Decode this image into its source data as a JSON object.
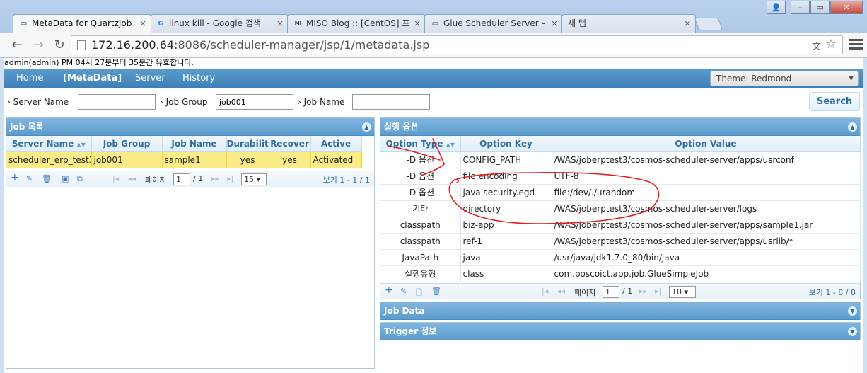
{
  "browser": {
    "tabs": [
      {
        "title": "MetaData for QuartzJob",
        "icon": "page-icon"
      },
      {
        "title": "linux kill - Google 검색",
        "icon": "google-icon"
      },
      {
        "title": "MISO Blog :: [CentOS] 프",
        "icon": "miso-icon"
      },
      {
        "title": "Glue Scheduler Server –",
        "icon": "page-icon"
      },
      {
        "title": "새 탭",
        "icon": ""
      }
    ],
    "url_host": "172.16.200.64",
    "url_rest": ":8086/scheduler-manager/jsp/1/metadata.jsp"
  },
  "notice": "admin(admin) PM 04시 27분부터 35분간 유효합니다.",
  "nav": {
    "items": [
      "Home",
      "[MetaData]",
      "Server",
      "History"
    ],
    "theme": "Theme: Redmond"
  },
  "filter": {
    "server_name_label": "Server Name",
    "server_name_value": "",
    "job_group_label": "Job Group",
    "job_group_value": "job001",
    "job_name_label": "Job Name",
    "job_name_value": "",
    "search": "Search"
  },
  "job_panel": {
    "title": "Job 목록",
    "columns": [
      "Server Name",
      "Job Group",
      "Job Name",
      "Durabilit",
      "Recover",
      "Active"
    ],
    "rows": [
      [
        "scheduler_erp_test3",
        "job001",
        "sample1",
        "yes",
        "yes",
        "Activated"
      ]
    ],
    "pager": {
      "page_label": "페이지",
      "page": "1",
      "total": "/ 1",
      "size": "15",
      "info": "보기 1 - 1 / 1"
    }
  },
  "option_panel": {
    "title": "실행 옵션",
    "columns": [
      "Option Type",
      "Option Key",
      "Option Value"
    ],
    "rows": [
      [
        "-D 옵션",
        "CONFIG_PATH",
        "/WAS/joberptest3/cosmos-scheduler-server/apps/usrconf"
      ],
      [
        "-D 옵션",
        "file.encoding",
        "UTF-8"
      ],
      [
        "-D 옵션",
        "java.security.egd",
        "file:/dev/./urandom"
      ],
      [
        "기타",
        "directory",
        "/WAS/joberptest3/cosmos-scheduler-server/logs"
      ],
      [
        "classpath",
        "biz-app",
        "/WAS/joberptest3/cosmos-scheduler-server/apps/sample1.jar"
      ],
      [
        "classpath",
        "ref-1",
        "/WAS/joberptest3/cosmos-scheduler-server/apps/usrlib/*"
      ],
      [
        "JavaPath",
        "java",
        "/usr/java/jdk1.7.0_80/bin/java"
      ],
      [
        "실행유형",
        "class",
        "com.poscoict.app.job.GlueSimpleJob"
      ]
    ],
    "pager": {
      "page_label": "페이지",
      "page": "1",
      "total": "/ 1",
      "size": "10",
      "info": "보기 1 - 8 / 8"
    }
  },
  "job_data_panel": {
    "title": "Job Data"
  },
  "trigger_panel": {
    "title": "Trigger 정보"
  },
  "colors": {
    "header": "#5c9ccc",
    "selected_row": "#fbec88",
    "annotation": "#e0201e"
  }
}
